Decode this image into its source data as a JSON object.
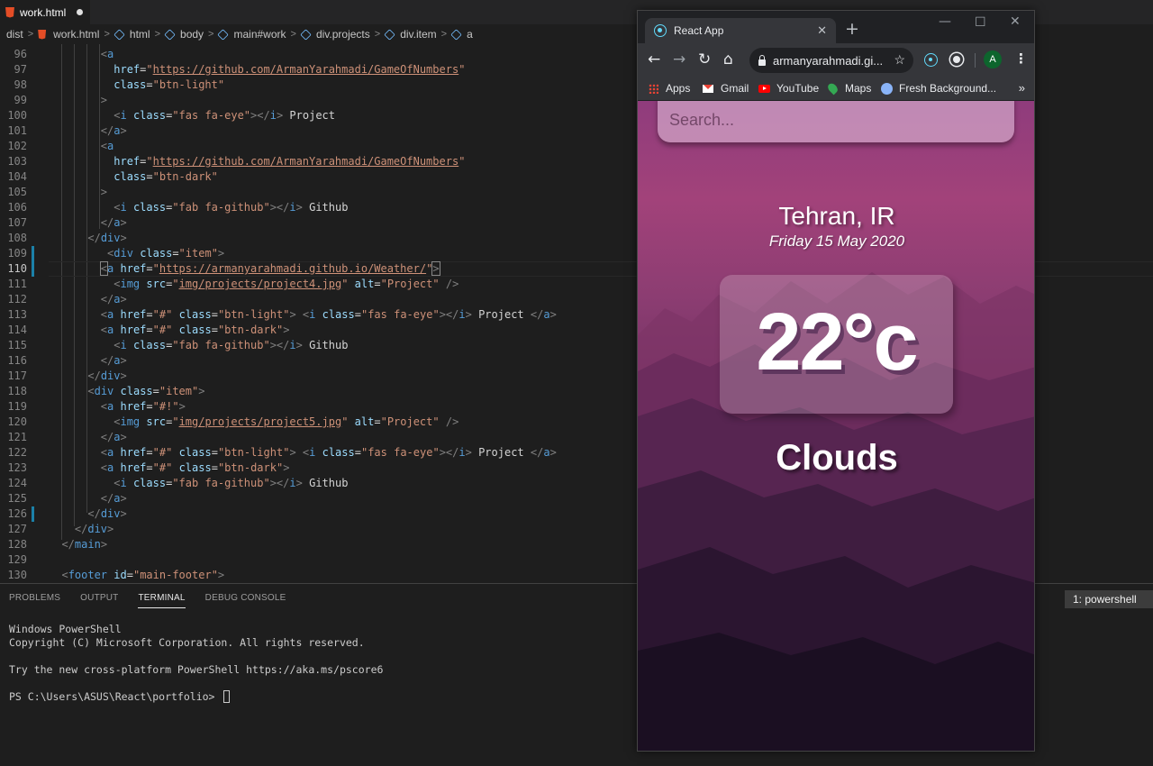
{
  "editor": {
    "tab_title": "work.html",
    "breadcrumb": [
      "dist",
      "work.html",
      "html",
      "body",
      "main#work",
      "div.projects",
      "div.item",
      "a"
    ],
    "lines": [
      {
        "n": "96"
      },
      {
        "n": "97"
      },
      {
        "n": "98"
      },
      {
        "n": "99"
      },
      {
        "n": "100"
      },
      {
        "n": "101"
      },
      {
        "n": "102"
      },
      {
        "n": "103"
      },
      {
        "n": "104"
      },
      {
        "n": "105"
      },
      {
        "n": "106"
      },
      {
        "n": "107"
      },
      {
        "n": "108"
      },
      {
        "n": "109"
      },
      {
        "n": "110"
      },
      {
        "n": "111"
      },
      {
        "n": "112"
      },
      {
        "n": "113"
      },
      {
        "n": "114"
      },
      {
        "n": "115"
      },
      {
        "n": "116"
      },
      {
        "n": "117"
      },
      {
        "n": "118"
      },
      {
        "n": "119"
      },
      {
        "n": "120"
      },
      {
        "n": "121"
      },
      {
        "n": "122"
      },
      {
        "n": "123"
      },
      {
        "n": "124"
      },
      {
        "n": "125"
      },
      {
        "n": "126"
      },
      {
        "n": "127"
      },
      {
        "n": "128"
      },
      {
        "n": "129"
      },
      {
        "n": "130"
      }
    ],
    "strings": {
      "url_game": "https://github.com/ArmanYarahmadi/GameOfNumbers",
      "url_weather": "https://armanyarahmadi.github.io/Weather/",
      "btn_light": "btn-light",
      "btn_dark": "btn-dark",
      "fa_eye": "fas fa-eye",
      "fa_github": "fab fa-github",
      "item": "item",
      "img4": "img/projects/project4.jpg",
      "img5": "img/projects/project5.jpg",
      "alt": "Project",
      "hash": "#",
      "hash_bang": "#!",
      "main_footer": "main-footer",
      "txt_project": "Project",
      "txt_github": "Github"
    }
  },
  "panel": {
    "tabs": [
      "PROBLEMS",
      "OUTPUT",
      "TERMINAL",
      "DEBUG CONSOLE"
    ],
    "active_tab": "TERMINAL",
    "terminal_select": "1: powershell",
    "terminal_lines": [
      "Windows PowerShell",
      "Copyright (C) Microsoft Corporation. All rights reserved.",
      "",
      "Try the new cross-platform PowerShell https://aka.ms/pscore6",
      "",
      "PS C:\\Users\\ASUS\\React\\portfolio> "
    ]
  },
  "browser": {
    "tab_title": "React App",
    "url": "armanyarahmadi.gi...",
    "avatar_letter": "A",
    "bookmarks": [
      "Apps",
      "Gmail",
      "YouTube",
      "Maps",
      "Fresh Background..."
    ],
    "bookmarks_more": "»"
  },
  "weather_app": {
    "search_placeholder": "Search...",
    "location": "Tehran, IR",
    "date": "Friday 15 May 2020",
    "temperature": "22°c",
    "condition": "Clouds"
  },
  "colors": {
    "tag": "#569cd6",
    "attribute": "#9cdcfe",
    "string": "#ce9178",
    "accent_react": "#61dafb"
  }
}
